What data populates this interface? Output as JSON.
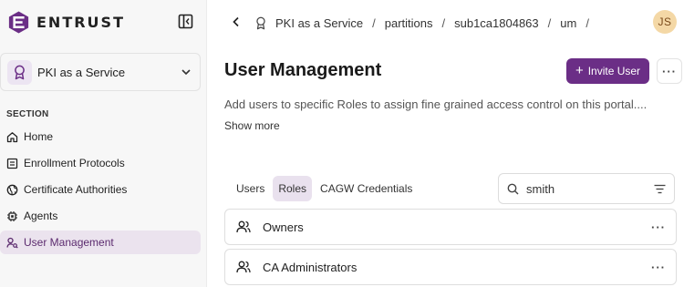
{
  "brand": {
    "name": "ENTRUST",
    "accent_color": "#6b2e86"
  },
  "workspace": {
    "label": "PKI as a Service",
    "icon": "award-ribbon-icon"
  },
  "sidebar": {
    "section_label": "SECTION",
    "items": [
      {
        "label": "Home",
        "icon": "home-icon",
        "active": false
      },
      {
        "label": "Enrollment Protocols",
        "icon": "document-list-icon",
        "active": false
      },
      {
        "label": "Certificate Authorities",
        "icon": "globe-icon",
        "active": false
      },
      {
        "label": "Agents",
        "icon": "chip-icon",
        "active": false
      },
      {
        "label": "User Management",
        "icon": "user-key-icon",
        "active": true
      }
    ]
  },
  "breadcrumb": {
    "items": [
      "PKI as a Service",
      "partitions",
      "sub1ca1804863",
      "um"
    ],
    "separator": "/"
  },
  "user": {
    "initials": "JS"
  },
  "page": {
    "title": "User Management",
    "invite_label": "Invite User",
    "more_label": "···",
    "description": "Add users to specific Roles to assign fine grained access control on this portal....",
    "show_more_label": "Show more"
  },
  "tabs": [
    {
      "label": "Users",
      "active": false
    },
    {
      "label": "Roles",
      "active": true
    },
    {
      "label": "CAGW Credentials",
      "active": false
    }
  ],
  "search": {
    "value": "smith",
    "placeholder": ""
  },
  "roles": [
    {
      "label": "Owners",
      "icon": "users-icon",
      "more_label": "···"
    },
    {
      "label": "CA Administrators",
      "icon": "users-icon",
      "more_label": "···"
    }
  ]
}
